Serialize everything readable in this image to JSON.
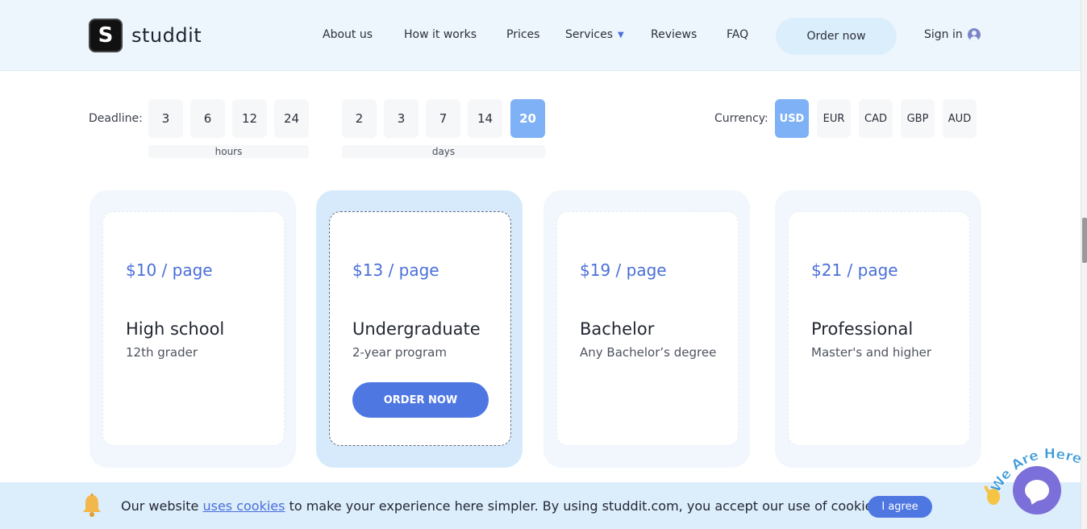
{
  "brand": {
    "name": "studdit",
    "mark": "S"
  },
  "nav": {
    "about": "About us",
    "how": "How it works",
    "prices": "Prices",
    "services": "Services",
    "reviews": "Reviews",
    "faq": "FAQ",
    "order": "Order now",
    "signin": "Sign in"
  },
  "deadline": {
    "label": "Deadline:",
    "hours": [
      "3",
      "6",
      "12",
      "24"
    ],
    "hours_label": "hours",
    "days": [
      "2",
      "3",
      "7",
      "14",
      "20"
    ],
    "days_label": "days",
    "selected": "20"
  },
  "currency": {
    "label": "Currency:",
    "options": [
      "USD",
      "EUR",
      "CAD",
      "GBP",
      "AUD"
    ],
    "selected": "USD"
  },
  "plans": [
    {
      "price": "$10 / page",
      "level": "High school",
      "desc": "12th grader"
    },
    {
      "price": "$13 / page",
      "level": "Undergraduate",
      "desc": "2-year program",
      "cta": "ORDER NOW"
    },
    {
      "price": "$19 / page",
      "level": "Bachelor",
      "desc": "Any Bachelor’s degree"
    },
    {
      "price": "$21 / page",
      "level": "Professional",
      "desc": "Master's and higher"
    }
  ],
  "cookie": {
    "before": "Our website ",
    "link": "uses cookies",
    "after": " to make your experience here simpler. By using studdit.com, you accept our use of cookies",
    "agree": "I agree"
  },
  "chat": {
    "badge": "We Are Here!"
  },
  "colors": {
    "accent": "#4f77e2",
    "selected": "#7fb1f6",
    "header_bg": "#eef6fd",
    "chat": "#7b6fd9"
  }
}
